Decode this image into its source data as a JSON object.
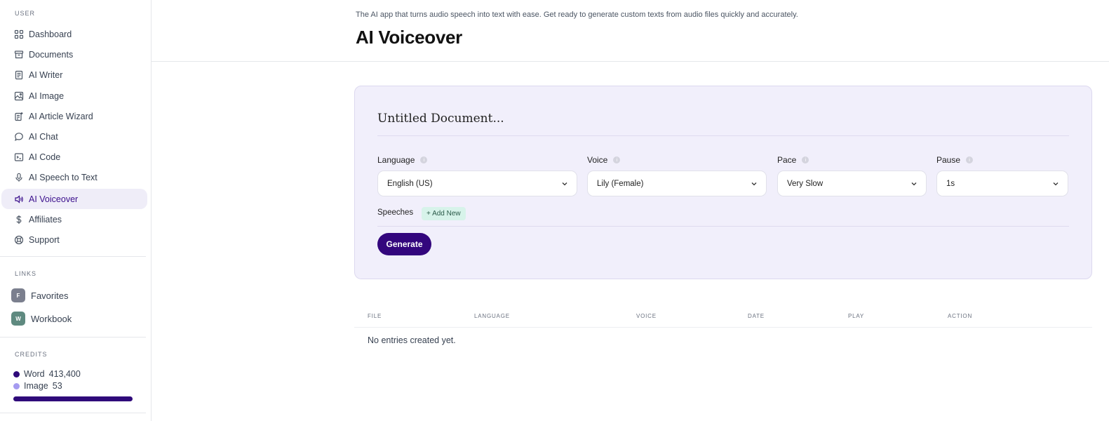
{
  "sidebar": {
    "user_title": "USER",
    "items": [
      {
        "label": "Dashboard",
        "icon": "dashboard-icon"
      },
      {
        "label": "Documents",
        "icon": "archive-icon"
      },
      {
        "label": "AI Writer",
        "icon": "document-icon"
      },
      {
        "label": "AI Image",
        "icon": "image-icon"
      },
      {
        "label": "AI Article Wizard",
        "icon": "wizard-icon"
      },
      {
        "label": "AI Chat",
        "icon": "chat-icon"
      },
      {
        "label": "AI Code",
        "icon": "terminal-icon"
      },
      {
        "label": "AI Speech to Text",
        "icon": "microphone-icon"
      },
      {
        "label": "AI Voiceover",
        "icon": "speaker-icon"
      },
      {
        "label": "Affiliates",
        "icon": "dollar-icon"
      },
      {
        "label": "Support",
        "icon": "lifebuoy-icon"
      }
    ],
    "links_title": "LINKS",
    "links": [
      {
        "label": "Favorites",
        "badge": "F",
        "color": "#7b7f8e"
      },
      {
        "label": "Workbook",
        "badge": "W",
        "color": "#5f8a80"
      }
    ],
    "credits_title": "CREDITS",
    "credits": [
      {
        "label": "Word",
        "value": "413,400",
        "color": "#2f0a7a"
      },
      {
        "label": "Image",
        "value": "53",
        "color": "#a59bf0"
      }
    ],
    "credit_fill": 1.0
  },
  "header": {
    "subtitle": "The AI app that turns audio speech into text with ease. Get ready to generate custom texts from audio files quickly and accurately.",
    "title": "AI Voiceover"
  },
  "card": {
    "doc_title": "Untitled Document...",
    "fields": [
      {
        "label": "Language",
        "value": "English (US)"
      },
      {
        "label": "Voice",
        "value": "Lily (Female)"
      },
      {
        "label": "Pace",
        "value": "Very Slow"
      },
      {
        "label": "Pause",
        "value": "1s"
      }
    ],
    "speeches_label": "Speeches",
    "add_new_label": "+ Add New",
    "generate_label": "Generate"
  },
  "table": {
    "headers": [
      "FILE",
      "LANGUAGE",
      "VOICE",
      "DATE",
      "PLAY",
      "ACTION"
    ],
    "empty_message": "No entries created yet."
  },
  "colors": {
    "accent": "#33067d",
    "active_bg": "#efedf8",
    "card_bg": "#f1effb"
  }
}
